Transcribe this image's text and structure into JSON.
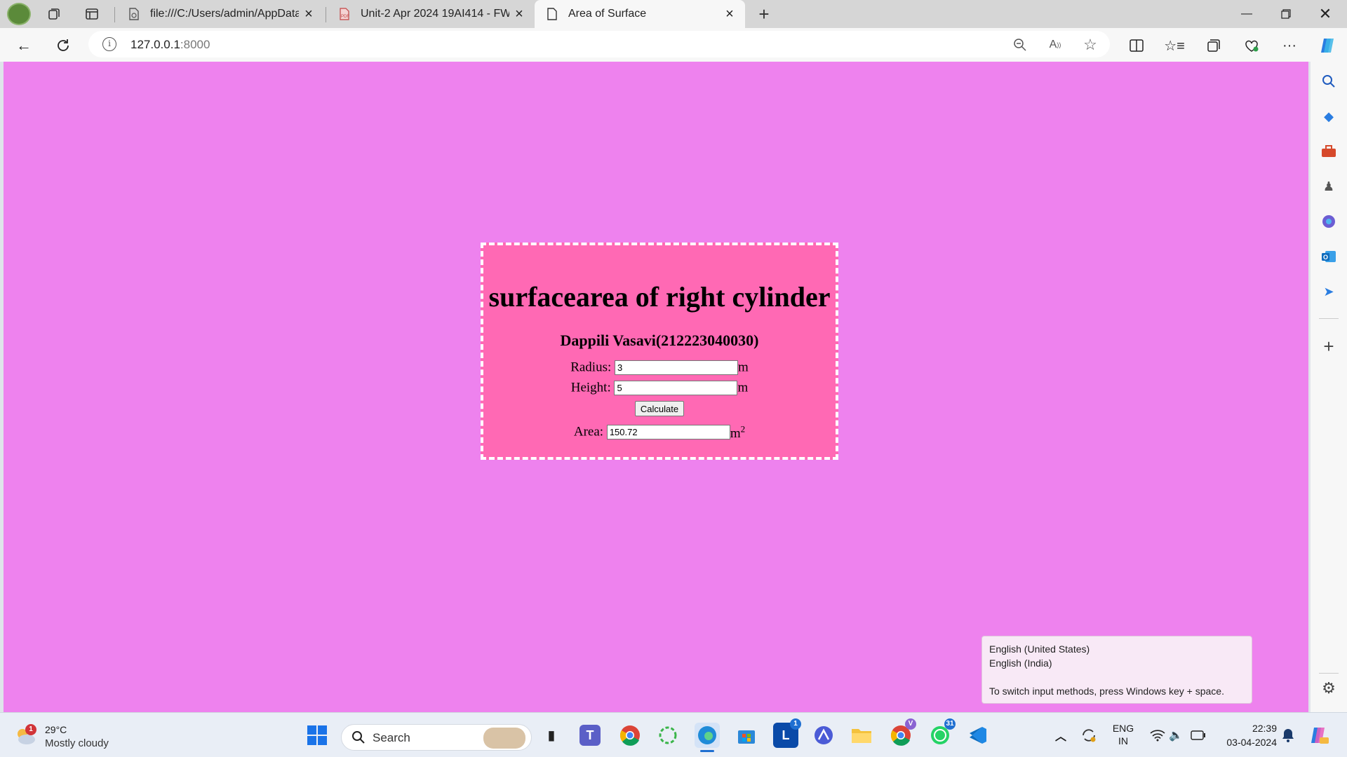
{
  "browser": {
    "tabs": [
      {
        "title": "file:///C:/Users/admin/AppData/L",
        "favicon": "file-icon"
      },
      {
        "title": "Unit-2 Apr 2024 19AI414 - FWAD",
        "favicon": "pdf-icon"
      },
      {
        "title": "Area of Surface",
        "favicon": "page-icon",
        "active": true
      }
    ],
    "address": {
      "host": "127.0.0.1",
      "port": ":8000"
    }
  },
  "page": {
    "heading": "surfacearea of right cylinder",
    "author": "Dappili Vasavi(212223040030)",
    "radius": {
      "label": "Radius:",
      "value": "3",
      "unit": "m"
    },
    "height": {
      "label": "Height:",
      "value": "5",
      "unit": "m"
    },
    "calculate_label": "Calculate",
    "area": {
      "label": "Area:",
      "value": "150.72",
      "unit": "m",
      "exponent": "2"
    },
    "background_color": "#ee82ee",
    "card_color": "#ff69b4"
  },
  "ime_popup": {
    "line1": "English (United States)",
    "line2": "English (India)",
    "hint": "To switch input methods, press Windows key + space."
  },
  "taskbar": {
    "weather": {
      "temp": "29°C",
      "condition": "Mostly cloudy",
      "badge": "1"
    },
    "search_label": "Search",
    "lang": {
      "line1": "ENG",
      "line2": "IN"
    },
    "time": "22:39",
    "date": "03-04-2024",
    "badges": {
      "linkedin": "1",
      "whatsapp": "31",
      "chrome_profile": "V"
    }
  }
}
